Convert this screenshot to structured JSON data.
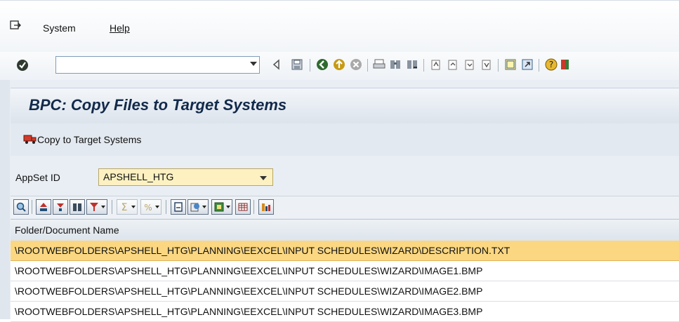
{
  "menu": {
    "system": "System",
    "help": "Help"
  },
  "toolbar": {
    "command_field_value": ""
  },
  "page": {
    "title": "BPC: Copy Files to Target Systems"
  },
  "app_toolbar": {
    "copy_label": "Copy to Target Systems"
  },
  "selection": {
    "label": "AppSet ID",
    "value": "APSHELL_HTG"
  },
  "table": {
    "column_header": "Folder/Document Name",
    "rows": [
      "\\ROOTWEBFOLDERS\\APSHELL_HTG\\PLANNING\\EEXCEL\\INPUT SCHEDULES\\WIZARD\\DESCRIPTION.TXT",
      "\\ROOTWEBFOLDERS\\APSHELL_HTG\\PLANNING\\EEXCEL\\INPUT SCHEDULES\\WIZARD\\IMAGE1.BMP",
      "\\ROOTWEBFOLDERS\\APSHELL_HTG\\PLANNING\\EEXCEL\\INPUT SCHEDULES\\WIZARD\\IMAGE2.BMP",
      "\\ROOTWEBFOLDERS\\APSHELL_HTG\\PLANNING\\EEXCEL\\INPUT SCHEDULES\\WIZARD\\IMAGE3.BMP"
    ],
    "selected_row": 0
  },
  "colors": {
    "title": "#12294a",
    "selected_row": "#fbd781",
    "appset_field": "#fdf1c2"
  }
}
